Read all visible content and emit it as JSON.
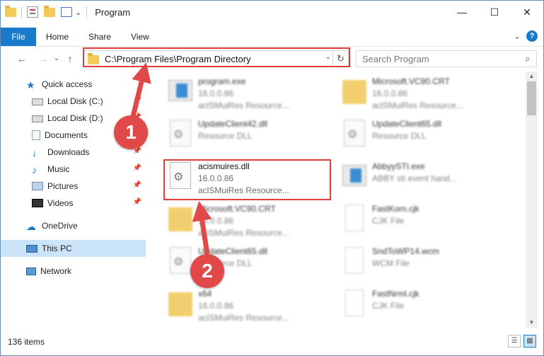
{
  "window": {
    "title": "Program",
    "controls": {
      "minimize": "—",
      "maximize": "☐",
      "close": "✕"
    }
  },
  "ribbon": {
    "tabs": [
      "File",
      "Home",
      "Share",
      "View"
    ],
    "expand_glyph": "⌄",
    "help_glyph": "?"
  },
  "address": {
    "path": "C:\\Program Files\\Program Directory",
    "dropdown_glyph": "⌄",
    "refresh_glyph": "↻"
  },
  "search": {
    "placeholder": "Search Program",
    "icon_glyph": "⌕"
  },
  "nav_glyphs": {
    "back": "←",
    "forward": "→",
    "recent": "⌄",
    "up": "↑"
  },
  "sidebar": {
    "items": [
      {
        "label": "Quick access",
        "icon": "star-icon",
        "pinned": false
      },
      {
        "label": "Local Disk (C:)",
        "icon": "drive-icon",
        "pinned": true
      },
      {
        "label": "Local Disk (D:)",
        "icon": "drive-icon",
        "pinned": true
      },
      {
        "label": "Documents",
        "icon": "documents-icon",
        "pinned": true
      },
      {
        "label": "Downloads",
        "icon": "download-icon",
        "pinned": true
      },
      {
        "label": "Music",
        "icon": "music-icon",
        "pinned": true
      },
      {
        "label": "Pictures",
        "icon": "pictures-icon",
        "pinned": true
      },
      {
        "label": "Videos",
        "icon": "videos-icon",
        "pinned": true
      },
      {
        "label": "OneDrive",
        "icon": "cloud-icon",
        "pinned": false
      },
      {
        "label": "This PC",
        "icon": "computer-icon",
        "pinned": false,
        "selected": true
      },
      {
        "label": "Network",
        "icon": "network-icon",
        "pinned": false
      }
    ]
  },
  "files": [
    {
      "name": "program.exe",
      "line2": "16.0.0.86",
      "line3": "aclSMuiRes Resource...",
      "kind": "exe"
    },
    {
      "name": "Microsoft.VC90.CRT",
      "line2": "16.0.0.86",
      "line3": "aclSMuiRes Resource...",
      "kind": "folder"
    },
    {
      "name": "UpdateClient42.dll",
      "line2": "Resource DLL",
      "line3": "",
      "kind": "dll"
    },
    {
      "name": "UpdateClient65.dll",
      "line2": "Resource DLL",
      "line3": "",
      "kind": "dll"
    },
    {
      "name": "acismuires.dll",
      "line2": "16.0.0.86",
      "line3": "aclSMuiRes Resource...",
      "kind": "dll",
      "highlighted": true
    },
    {
      "name": "AbbyySTI.exe",
      "line2": "ABBY sti event hand...",
      "line3": "",
      "kind": "exe"
    },
    {
      "name": "Microsoft.VC90.CRT",
      "line2": "16.0.0.86",
      "line3": "aclSMuiRes Resource...",
      "kind": "folder"
    },
    {
      "name": "FastKorn.cjk",
      "line2": "CJK File",
      "line3": "",
      "kind": "doc"
    },
    {
      "name": "UpdateClient65.dll",
      "line2": "Resource DLL",
      "line3": "",
      "kind": "dll"
    },
    {
      "name": "SndToWP14.wcm",
      "line2": "WCM File",
      "line3": "",
      "kind": "doc"
    },
    {
      "name": "x64",
      "line2": "16.0.0.86",
      "line3": "aclSMuiRes Resource...",
      "kind": "folder"
    },
    {
      "name": "FastNrml.cjk",
      "line2": "CJK File",
      "line3": "",
      "kind": "doc"
    }
  ],
  "status": {
    "item_count": "136 items"
  },
  "callouts": {
    "step1": "1",
    "step2": "2"
  },
  "colors": {
    "accent": "#1979ca",
    "highlight": "#e23c3c",
    "callout": "#e14848"
  }
}
